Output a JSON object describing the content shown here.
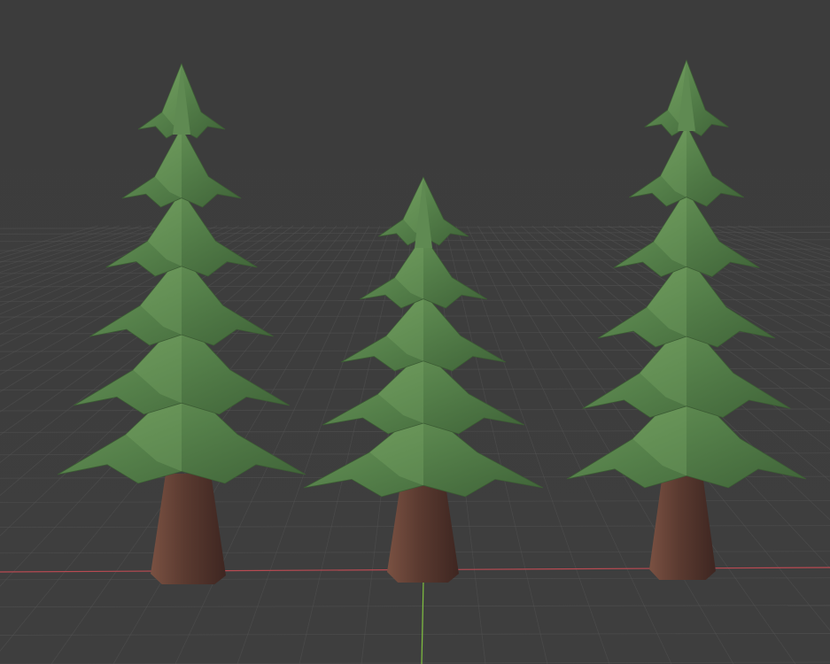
{
  "viewport": {
    "background_color": "#3d3d3d",
    "grid_color": "#555555",
    "x_axis_color": "#b84a52",
    "y_axis_color": "#7fbf3f"
  },
  "objects": [
    {
      "name": "pine-tree-left",
      "foliage_color": "#55804a",
      "trunk_color": "#5a3a30"
    },
    {
      "name": "pine-tree-center",
      "foliage_color": "#55804a",
      "trunk_color": "#5a3a30"
    },
    {
      "name": "pine-tree-right",
      "foliage_color": "#55804a",
      "trunk_color": "#5a3a30"
    }
  ]
}
